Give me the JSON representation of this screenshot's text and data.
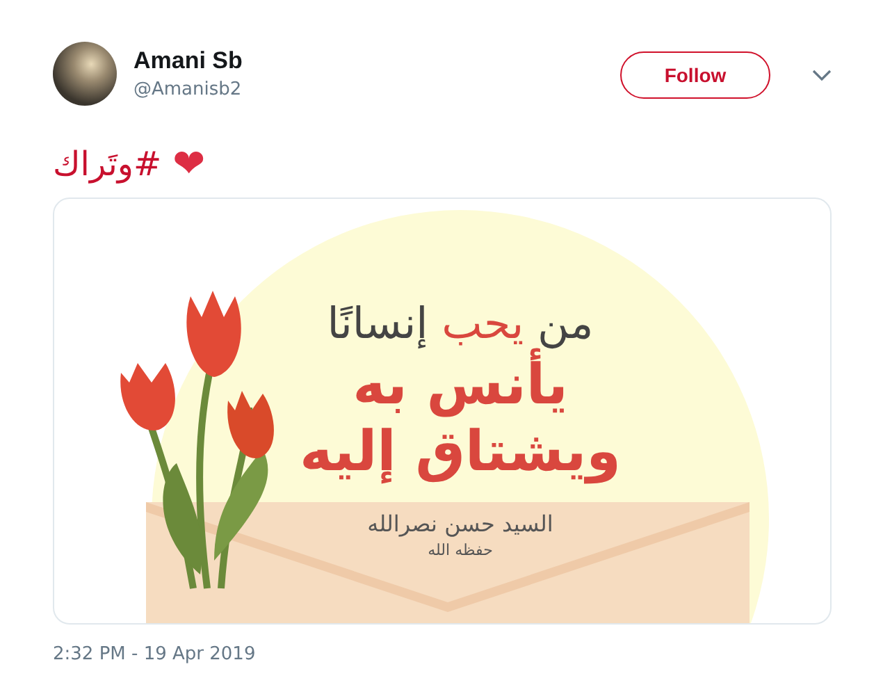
{
  "author": {
    "name": "Amani Sb",
    "handle": "@Amanisb2"
  },
  "follow_button": {
    "label": "Follow"
  },
  "tweet": {
    "hashtag": "#وتَراك",
    "emoji": "❤"
  },
  "image_card": {
    "quote_line_1": [
      {
        "text": "من",
        "highlight": false
      },
      {
        "text": "يحب",
        "highlight": true
      },
      {
        "text": "إنسانًا",
        "highlight": false
      }
    ],
    "quote_line_2": "يأنس به",
    "quote_line_3": "ويشتاق إليه",
    "attribution": "السيد حسن نصرالله",
    "attribution_note": "حفظه الله"
  },
  "timestamp": "2:32 PM - 19 Apr 2019"
}
